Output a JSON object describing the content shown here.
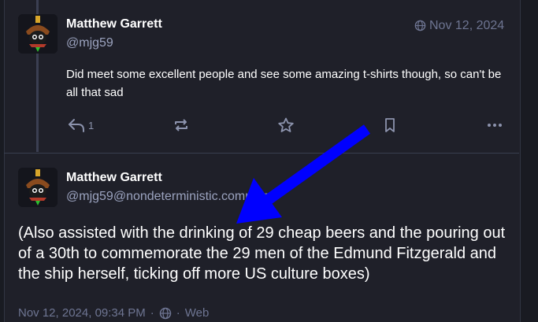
{
  "reply_post": {
    "author_name": "Matthew Garrett",
    "author_handle": "@mjg59",
    "date": "Nov 12, 2024",
    "visibility_icon": "globe-icon",
    "content": "Did meet some excellent people and see some amazing t-shirts though, so can't be all that sad",
    "actions": {
      "reply_icon": "reply-icon",
      "reply_count": "1",
      "boost_icon": "boost-icon",
      "favourite_icon": "star-icon",
      "bookmark_icon": "bookmark-icon",
      "more_icon": "more-icon"
    }
  },
  "main_post": {
    "author_name": "Matthew Garrett",
    "author_handle": "@mjg59@nondeterministic.computer",
    "content": "(Also assisted with the drinking of 29 cheap beers and the pouring out of a 30th to commemorate the 29 men of the Edmund Fitzgerald and the ship herself, ticking off more US culture boxes)",
    "timestamp": "Nov 12, 2024, 09:34 PM",
    "separator": "·",
    "visibility_icon": "globe-icon",
    "application": "Web"
  },
  "annotation": {
    "arrow_color": "#0000ff",
    "arrow_icon": "pointer-arrow-icon"
  },
  "colors": {
    "background": "#191b22",
    "column": "#1f2029",
    "text": "#ffffff",
    "muted": "#9ba3bf"
  }
}
